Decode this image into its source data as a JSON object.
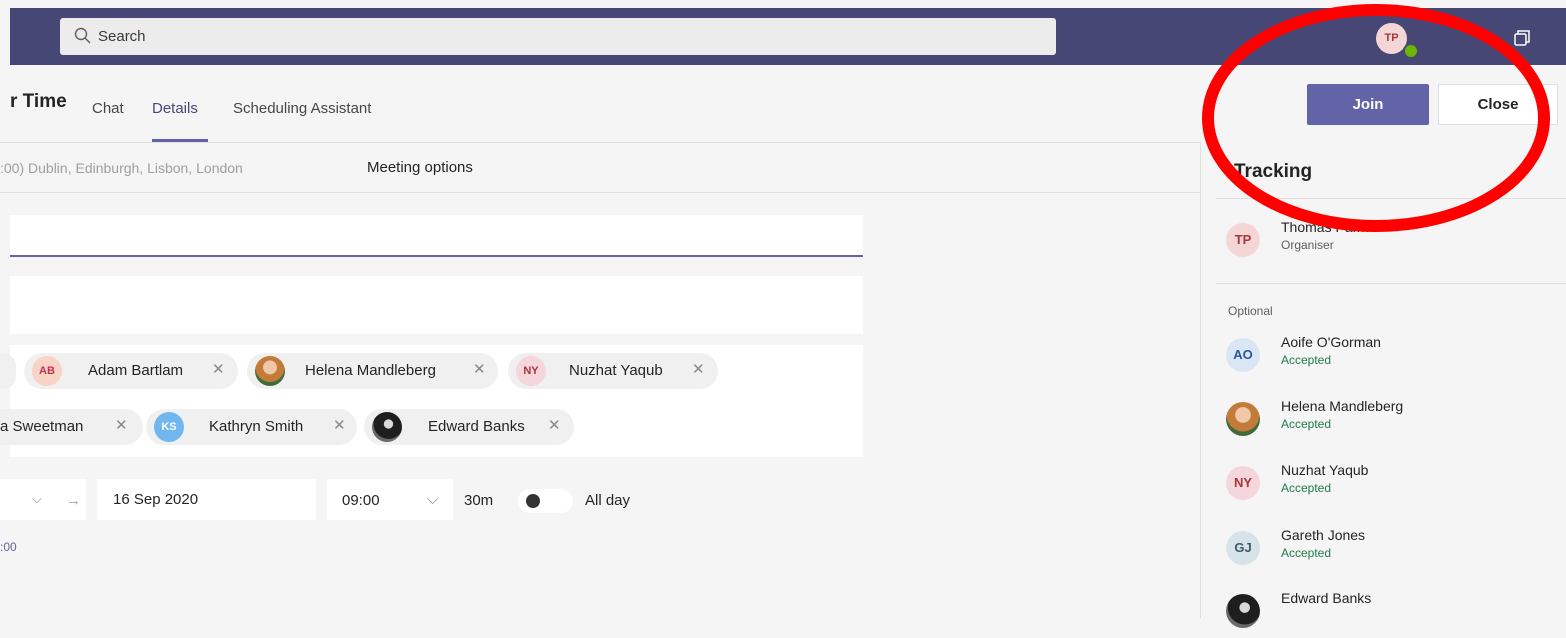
{
  "colors": {
    "brand": "#464775",
    "accent": "#6264a7",
    "accepted": "#237b4b",
    "annotation": "#ff0000"
  },
  "header": {
    "search_placeholder": "Search",
    "user_initials": "TP",
    "icons": {
      "search": "search-icon",
      "popout": "popout-icon",
      "status": "available-status-icon"
    }
  },
  "meeting": {
    "title_fragment": "r Time",
    "tabs": [
      {
        "label": "Chat"
      },
      {
        "label": "Details"
      },
      {
        "label": "Scheduling Assistant"
      }
    ],
    "active_tab": "Details",
    "join_label": "Join",
    "close_label": "Close",
    "timezone_fragment": ":00) Dublin, Edinburgh, Lisbon, London",
    "meeting_options": "Meeting options"
  },
  "attendees": {
    "row1": [
      {
        "initials": "AB",
        "name": "Adam Bartlam"
      },
      {
        "initials": "",
        "name": "Helena Mandleberg"
      },
      {
        "initials": "NY",
        "name": "Nuzhat Yaqub"
      }
    ],
    "row2": [
      {
        "initials": "",
        "name": "a Sweetman"
      },
      {
        "initials": "KS",
        "name": "Kathryn Smith"
      },
      {
        "initials": "",
        "name": "Edward Banks"
      }
    ],
    "remove_glyph": "✕"
  },
  "schedule": {
    "end_date": "16 Sep 2020",
    "end_time": "09:00",
    "duration": "30m",
    "all_day_label": "All day",
    "all_day": false,
    "timezone_short": ":00",
    "arrow": "→",
    "chevron": "⌵"
  },
  "tracking": {
    "title": "Tracking",
    "organiser": {
      "initials": "TP",
      "name": "Thomas Pal…",
      "role": "Organiser"
    },
    "optional_label": "Optional",
    "people": [
      {
        "initials": "AO",
        "name": "Aoife O'Gorman",
        "status": "Accepted"
      },
      {
        "initials": "",
        "name": "Helena Mandleberg",
        "status": "Accepted"
      },
      {
        "initials": "NY",
        "name": "Nuzhat Yaqub",
        "status": "Accepted"
      },
      {
        "initials": "GJ",
        "name": "Gareth Jones",
        "status": "Accepted"
      },
      {
        "initials": "",
        "name": "Edward Banks",
        "status": ""
      }
    ]
  }
}
